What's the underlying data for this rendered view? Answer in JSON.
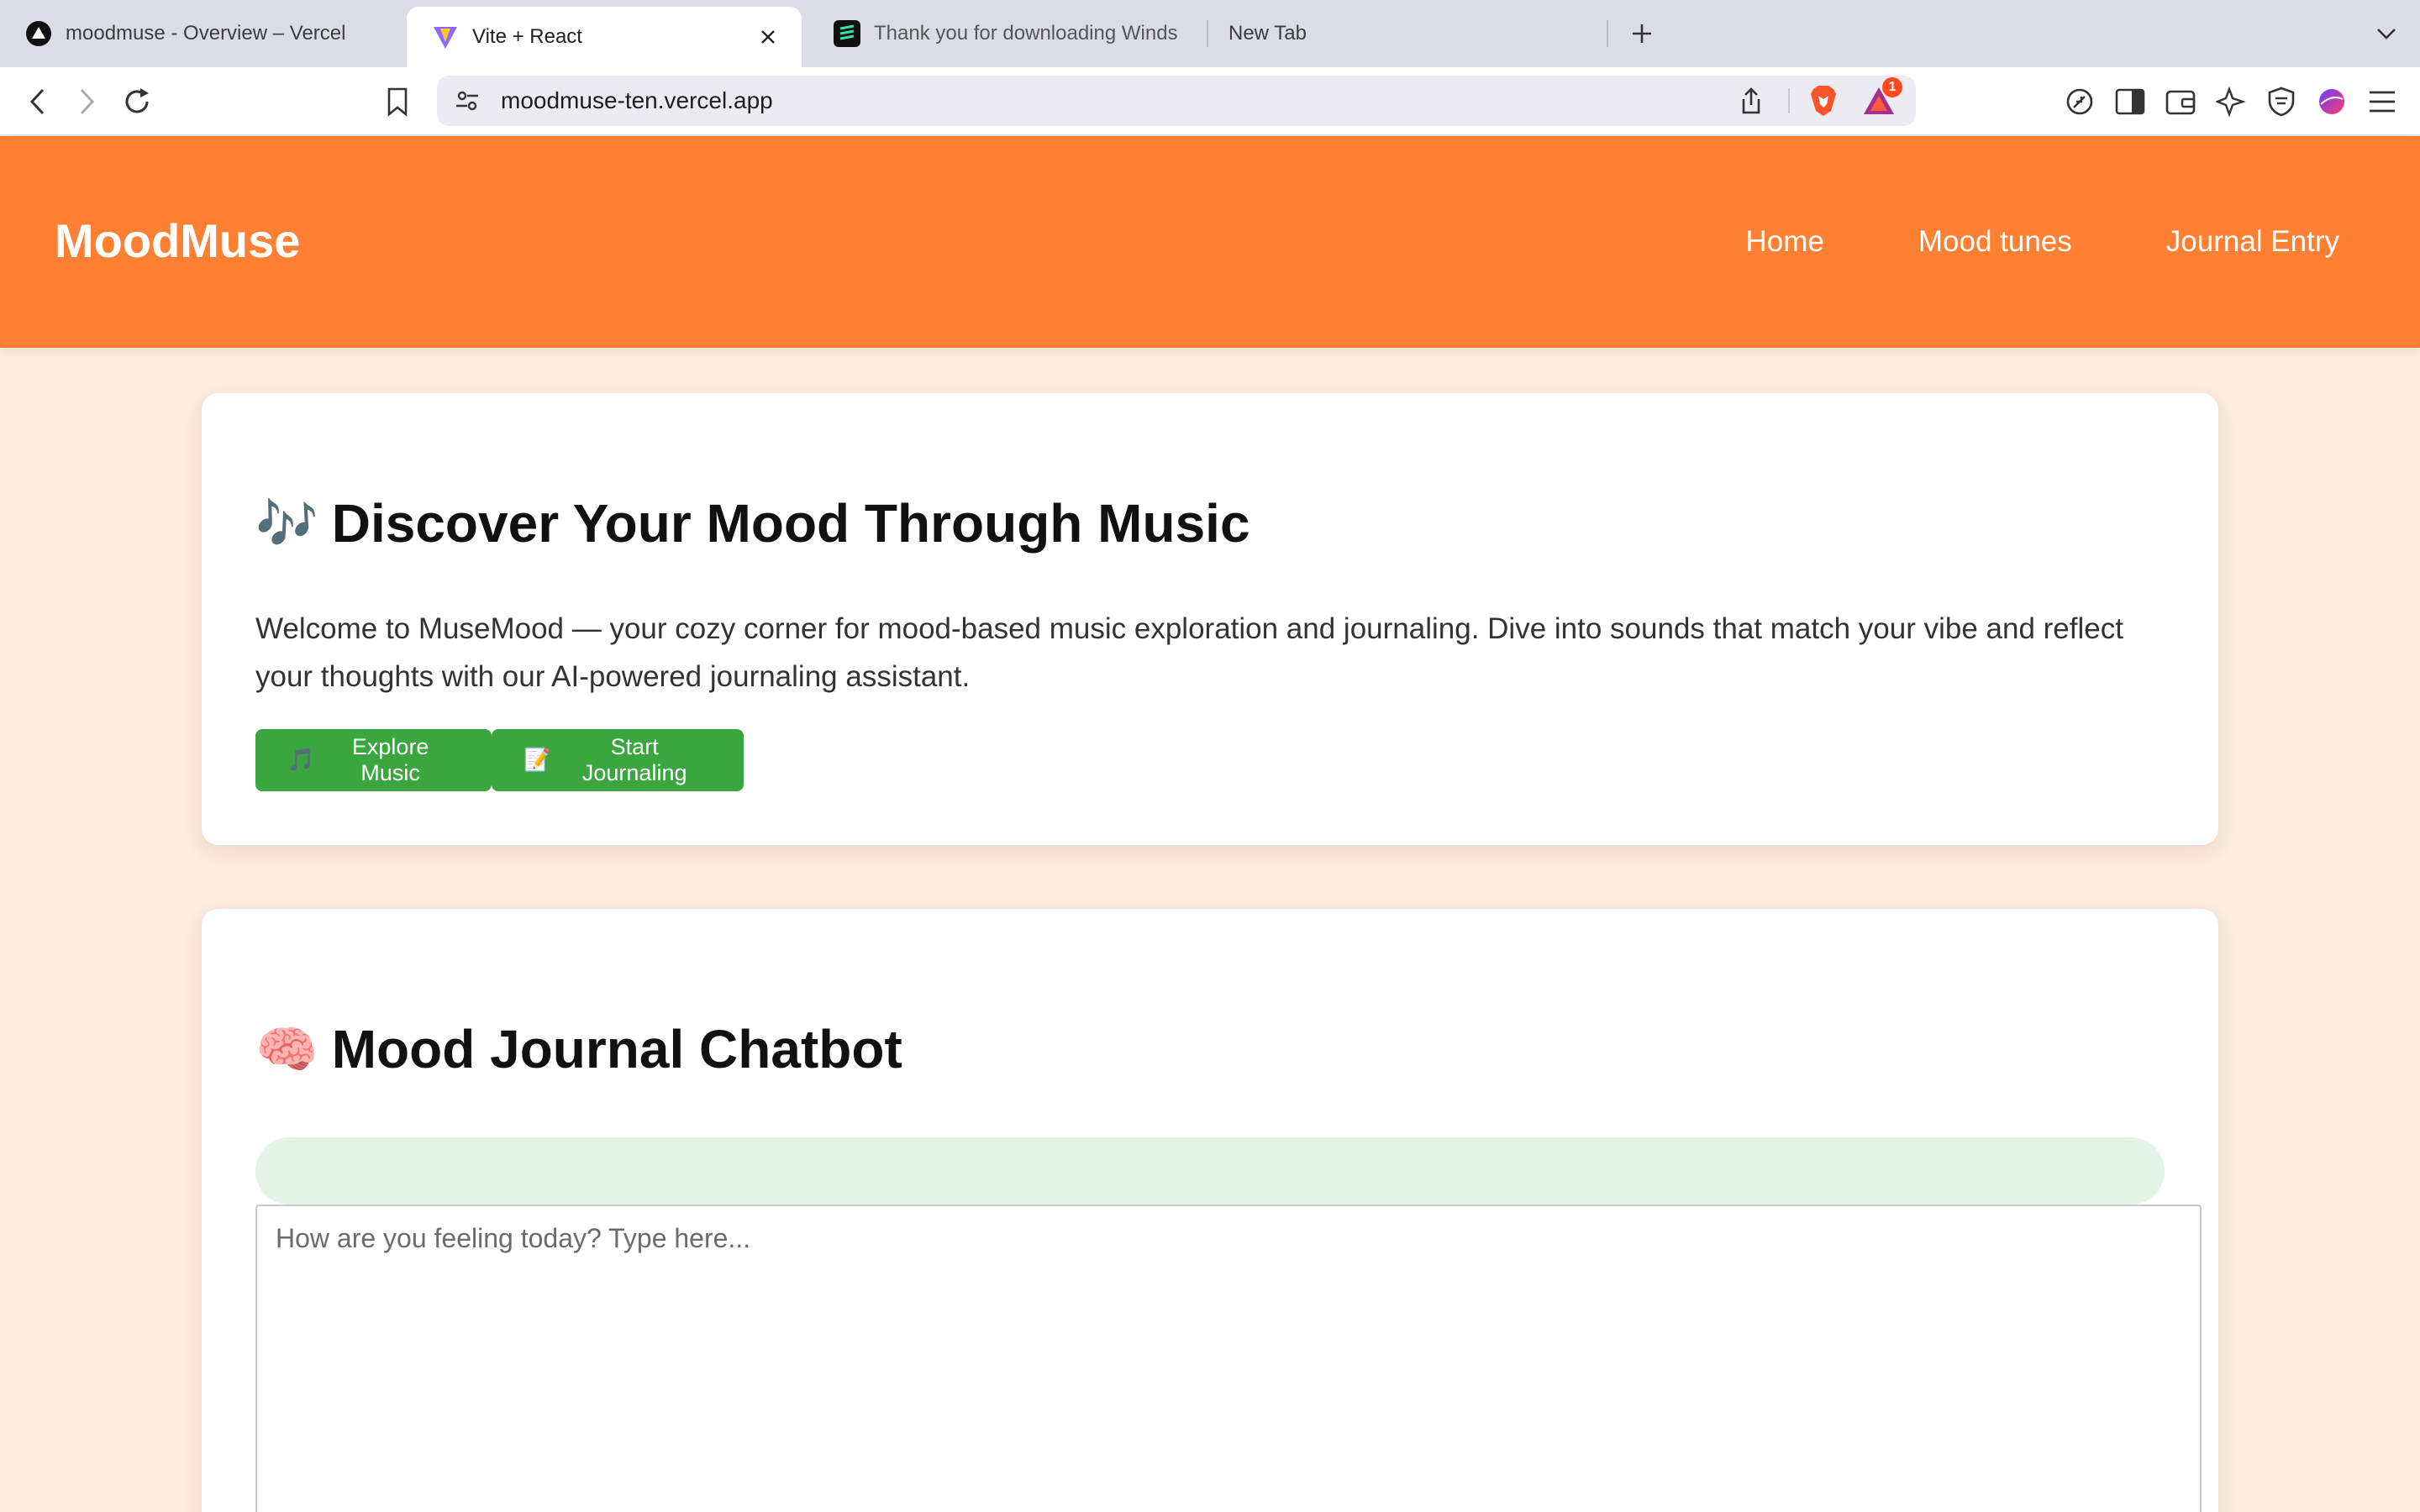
{
  "browser": {
    "tabs": [
      {
        "title": "moodmuse - Overview – Vercel",
        "icon": "vercel-logo-icon",
        "active": false
      },
      {
        "title": "Vite + React",
        "icon": "vite-logo-icon",
        "active": true
      },
      {
        "title": "Thank you for downloading Winds",
        "icon": "windsurf-logo-icon",
        "active": false
      },
      {
        "title": "New Tab",
        "icon": "",
        "active": false
      }
    ],
    "url": "moodmuse-ten.vercel.app",
    "notification_count": "1"
  },
  "header": {
    "brand": "MoodMuse",
    "nav": [
      {
        "label": "Home"
      },
      {
        "label": "Mood tunes"
      },
      {
        "label": "Journal Entry"
      }
    ],
    "color": "#ff8033"
  },
  "hero": {
    "emoji": "🎶",
    "title": "Discover Your Mood Through Music",
    "description": "Welcome to MuseMood — your cozy corner for mood-based music exploration and journaling. Dive into sounds that match your vibe and reflect your thoughts with our AI-powered journaling assistant.",
    "buttons": [
      {
        "icon": "🎵",
        "label": "Explore Music"
      },
      {
        "icon": "📝",
        "label": "Start Journaling"
      }
    ],
    "button_color": "#3ba63f"
  },
  "chatbot": {
    "emoji": "🧠",
    "title": "Mood Journal Chatbot",
    "input_placeholder": "How are you feeling today? Type here...",
    "input_value": ""
  }
}
